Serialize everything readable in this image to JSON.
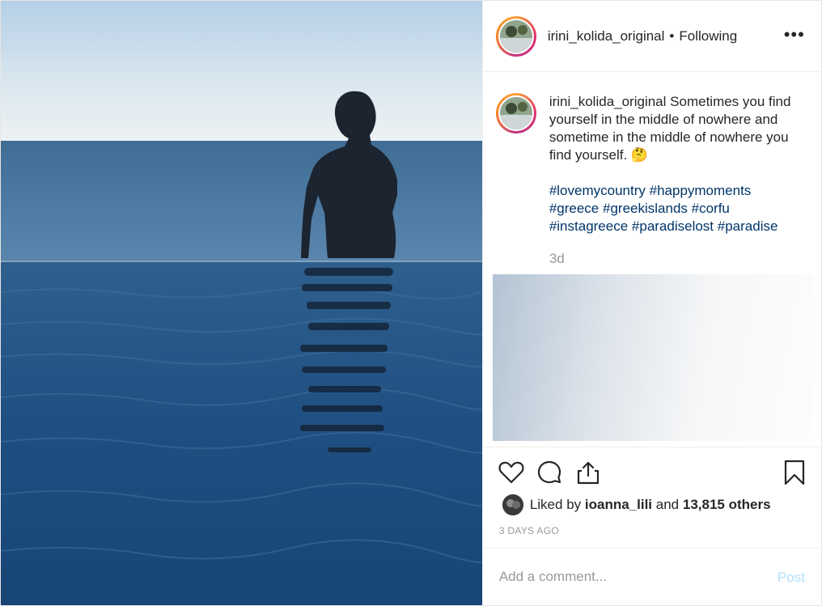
{
  "post": {
    "username": "irini_kolida_original",
    "follow_separator": "•",
    "follow_label": "Following",
    "more_label": "•••"
  },
  "caption": {
    "username": "irini_kolida_original",
    "text": "Sometimes you find yourself in the middle of nowhere and sometime in the middle of nowhere you find yourself. 🤔",
    "hashtags": [
      "#lovemycountry",
      "#happymoments",
      "#greece",
      "#greekislands",
      "#corfu",
      "#instagreece",
      "#paradiselost",
      "#paradise"
    ],
    "time_short": "3d"
  },
  "likes": {
    "prefix": "Liked by",
    "user": "ioanna_lili",
    "and": "and",
    "others": "13,815 others"
  },
  "date_label": "3 DAYS AGO",
  "comment": {
    "placeholder": "Add a comment...",
    "post_label": "Post"
  },
  "icons": {
    "like": "heart-icon",
    "comment": "comment-icon",
    "share": "share-icon",
    "save": "bookmark-icon",
    "more": "more-options-icon"
  }
}
